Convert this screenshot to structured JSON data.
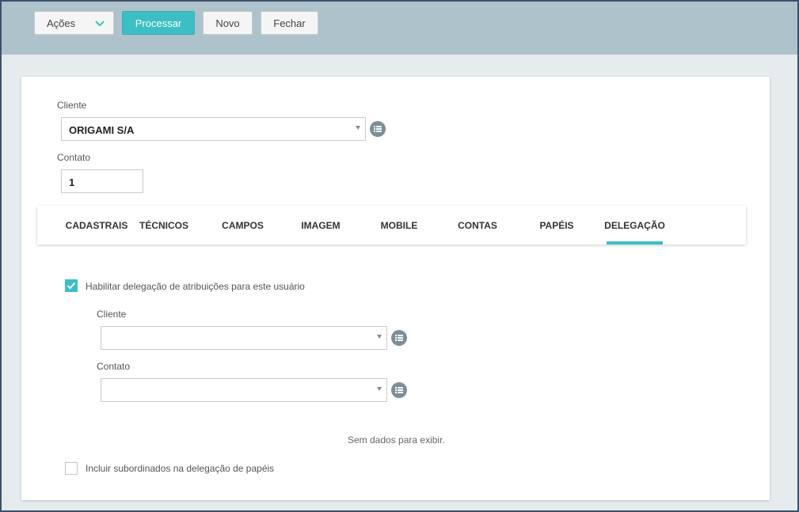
{
  "toolbar": {
    "actions_label": "Ações",
    "process_label": "Processar",
    "new_label": "Novo",
    "close_label": "Fechar"
  },
  "form": {
    "client_label": "Cliente",
    "client_value": "ORIGAMI S/A",
    "contact_label": "Contato",
    "contact_value": "1"
  },
  "tabs": [
    {
      "label": "CADASTRAIS",
      "active": false
    },
    {
      "label": "TÉCNICOS",
      "active": false
    },
    {
      "label": "CAMPOS",
      "active": false
    },
    {
      "label": "IMAGEM",
      "active": false
    },
    {
      "label": "MOBILE",
      "active": false
    },
    {
      "label": "CONTAS",
      "active": false
    },
    {
      "label": "PAPÉIS",
      "active": false
    },
    {
      "label": "DELEGAÇÃO",
      "active": true
    }
  ],
  "delegation": {
    "enable_label": "Habilitar delegação de atribuições para este usuário",
    "enable_checked": true,
    "client_label": "Cliente",
    "client_value": "",
    "contact_label": "Contato",
    "contact_value": "",
    "no_data_text": "Sem dados para exibir.",
    "include_sub_label": "Incluir subordinados na delegação de papéis",
    "include_sub_checked": false
  },
  "colors": {
    "accent": "#3bbfc5",
    "toolbar_bg": "#aec2cc",
    "page_bg": "#e6ebee",
    "icon_bg": "#7b8e99"
  },
  "icons": {
    "actions_chevron": "chevron-down-icon",
    "lookup": "list-icon",
    "check": "checkmark-icon"
  }
}
